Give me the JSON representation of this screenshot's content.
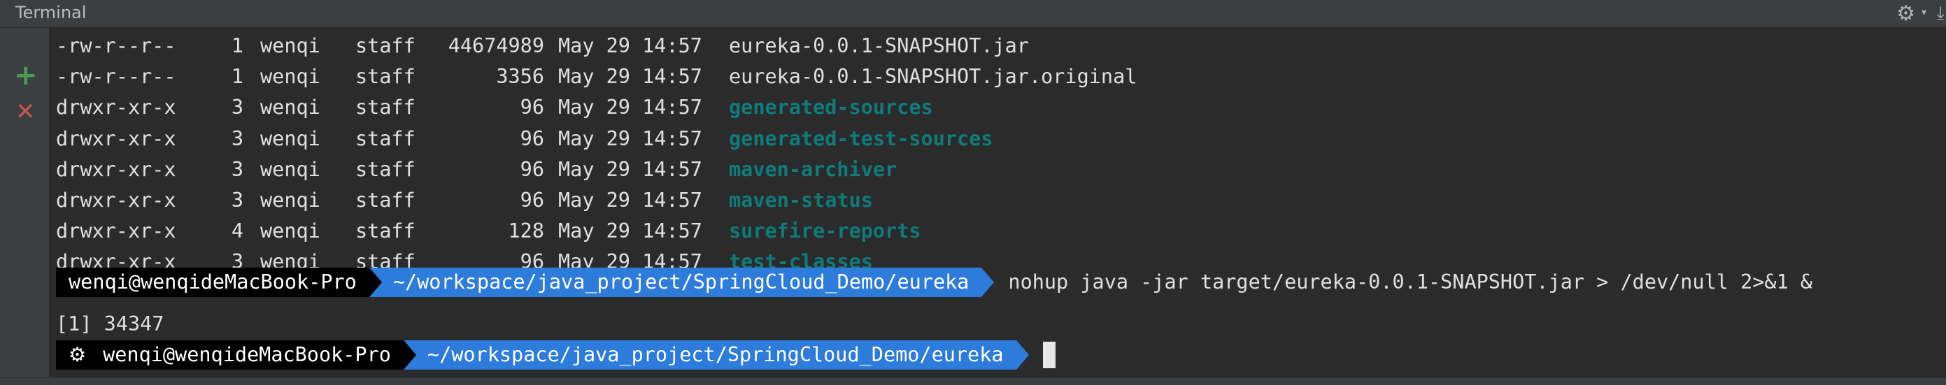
{
  "window": {
    "title": "Terminal",
    "icons": [
      "gear-icon",
      "hide-panel-icon",
      "add-session-icon",
      "close-session-icon"
    ]
  },
  "listing": [
    {
      "mode": "-rw-r--r--",
      "links": "1",
      "user": "wenqi",
      "group": "staff",
      "size": "44674989",
      "date": "May 29 14:57",
      "name": "eureka-0.0.1-SNAPSHOT.jar",
      "is_dir": false
    },
    {
      "mode": "-rw-r--r--",
      "links": "1",
      "user": "wenqi",
      "group": "staff",
      "size": "3356",
      "date": "May 29 14:57",
      "name": "eureka-0.0.1-SNAPSHOT.jar.original",
      "is_dir": false
    },
    {
      "mode": "drwxr-xr-x",
      "links": "3",
      "user": "wenqi",
      "group": "staff",
      "size": "96",
      "date": "May 29 14:57",
      "name": "generated-sources",
      "is_dir": true
    },
    {
      "mode": "drwxr-xr-x",
      "links": "3",
      "user": "wenqi",
      "group": "staff",
      "size": "96",
      "date": "May 29 14:57",
      "name": "generated-test-sources",
      "is_dir": true
    },
    {
      "mode": "drwxr-xr-x",
      "links": "3",
      "user": "wenqi",
      "group": "staff",
      "size": "96",
      "date": "May 29 14:57",
      "name": "maven-archiver",
      "is_dir": true
    },
    {
      "mode": "drwxr-xr-x",
      "links": "3",
      "user": "wenqi",
      "group": "staff",
      "size": "96",
      "date": "May 29 14:57",
      "name": "maven-status",
      "is_dir": true
    },
    {
      "mode": "drwxr-xr-x",
      "links": "4",
      "user": "wenqi",
      "group": "staff",
      "size": "128",
      "date": "May 29 14:57",
      "name": "surefire-reports",
      "is_dir": true
    },
    {
      "mode": "drwxr-xr-x",
      "links": "3",
      "user": "wenqi",
      "group": "staff",
      "size": "96",
      "date": "May 29 14:57",
      "name": "test-classes",
      "is_dir": true
    }
  ],
  "prompt1": {
    "user_host": "wenqi@wenqideMacBook-Pro",
    "path": "~/workspace/java_project/SpringCloud_Demo/eureka",
    "command": "nohup java -jar target/eureka-0.0.1-SNAPSHOT.jar > /dev/null 2>&1 &"
  },
  "job_output": "[1] 34347",
  "prompt2": {
    "user_host": "wenqi@wenqideMacBook-Pro",
    "path": "~/workspace/java_project/SpringCloud_Demo/eureka",
    "command": ""
  },
  "colors": {
    "background": "#2b2b2b",
    "text": "#e0e0e0",
    "directory": "#0f7b7b",
    "prompt_user_bg": "#000000",
    "prompt_path_bg": "#2d7bdb",
    "add_icon": "#499c54",
    "close_icon": "#c75450"
  }
}
